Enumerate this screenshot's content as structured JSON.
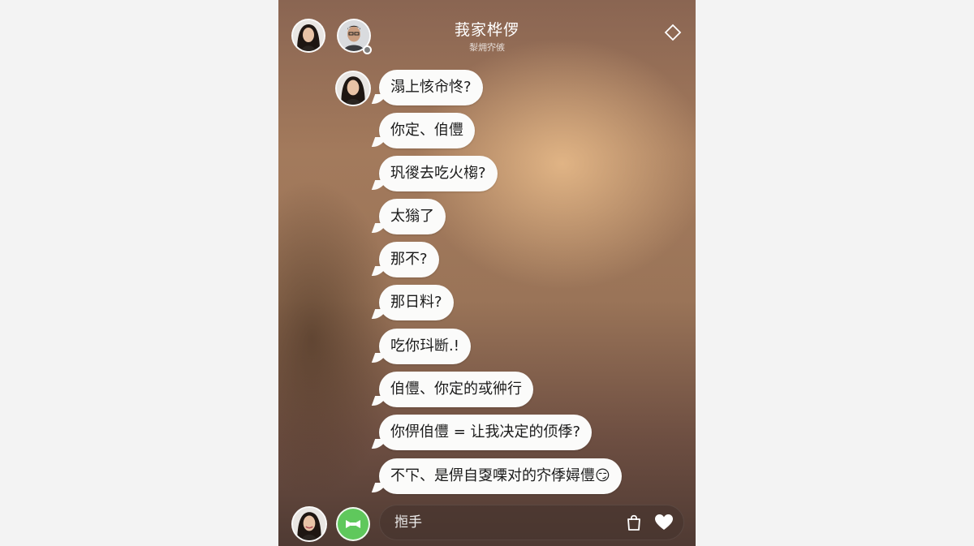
{
  "header": {
    "title": "莪家桦㑩",
    "subtitle": "㴝㶲㝏㑵",
    "menu_icon": "diamond-icon"
  },
  "messages": [
    {
      "text": "溻上㤥㠳㤏?"
    },
    {
      "text": "你定、㑑㒥"
    },
    {
      "text": "㺬㣭去吃火㮲?"
    },
    {
      "text": "太㺋了"
    },
    {
      "text": "那不?"
    },
    {
      "text": "那日料?"
    },
    {
      "text": "吃你㺶㫁.!"
    },
    {
      "text": "㑑㒥、你定的㦯㣡行"
    },
    {
      "text": "你㑭㑑㒥 = 让我决定的㑔㑧?"
    },
    {
      "text": "不㓀、是㑭自㪅㗚对的㝏㑧㜦㒥",
      "emoji": "😏"
    }
  ],
  "composer": {
    "input_text": "搄手",
    "bag_icon": "shopping-bag-icon",
    "heart_icon": "heart-icon",
    "action_icon": "green-link-icon"
  },
  "colors": {
    "bubble": "#fbfbfa",
    "accent_green": "#5fc85c"
  }
}
